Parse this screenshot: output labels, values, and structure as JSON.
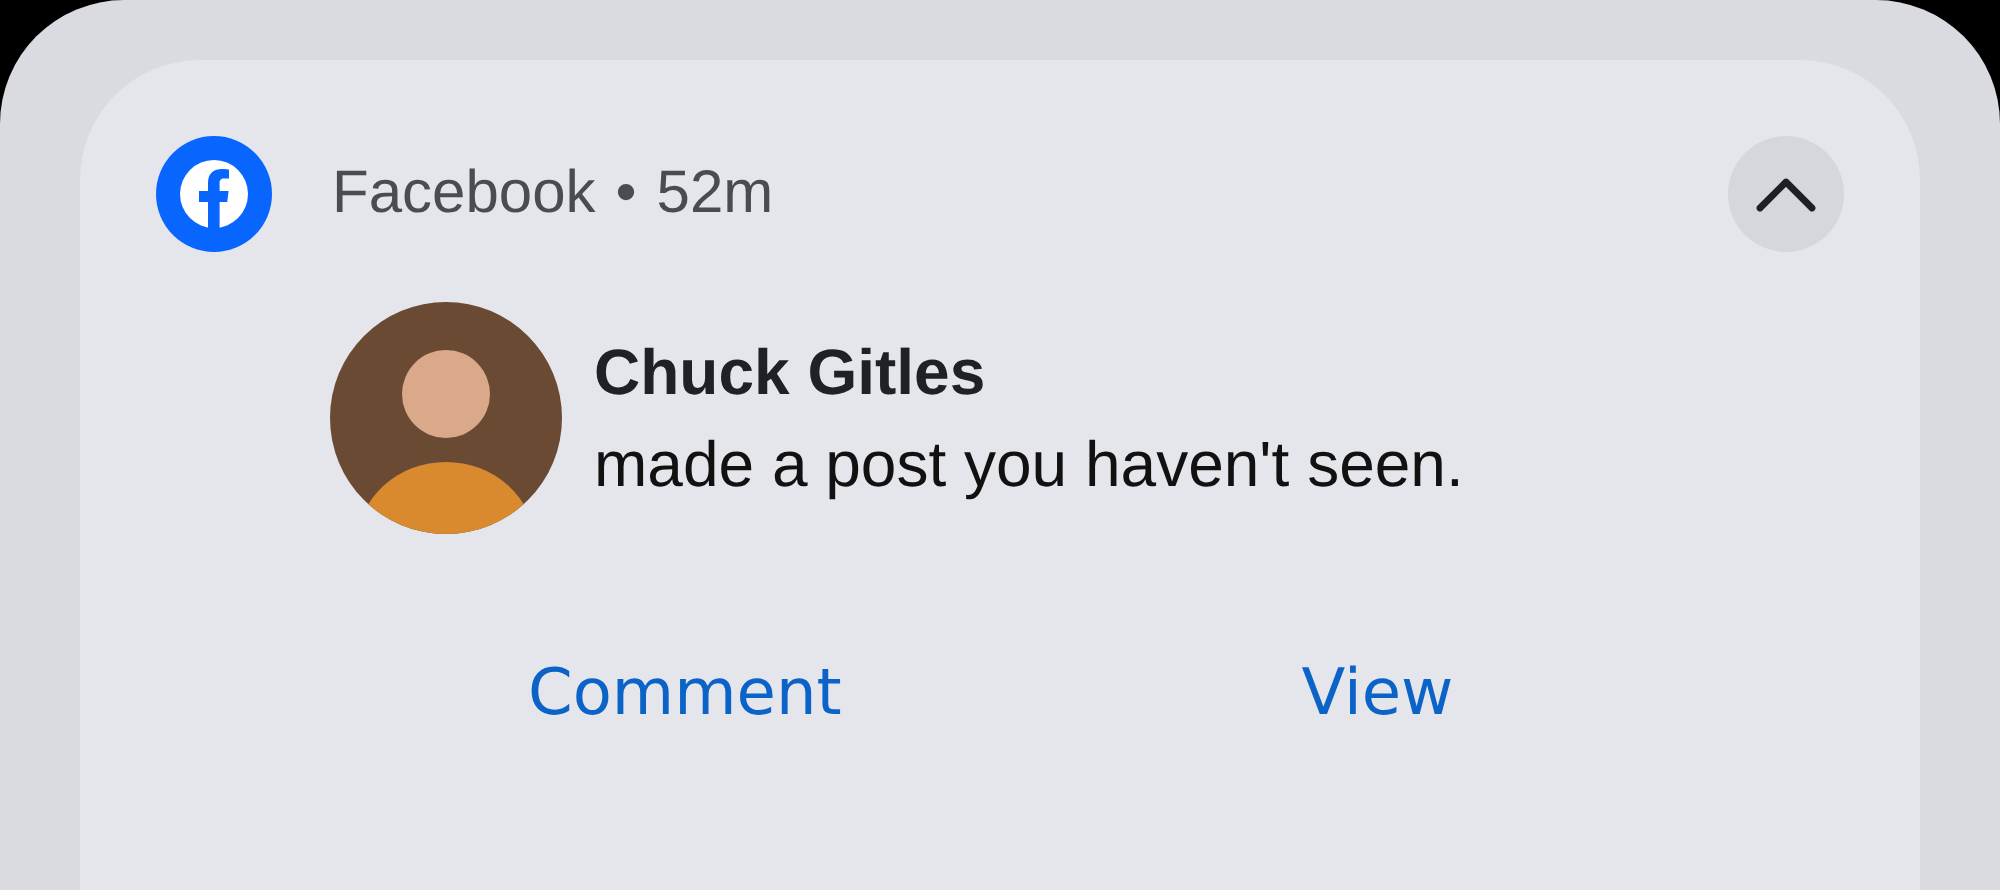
{
  "notification": {
    "app": "Facebook",
    "separator": "•",
    "time": "52m",
    "expanded": true,
    "sender": "Chuck Gitles",
    "message": "made a post you haven't seen.",
    "actions": [
      "Comment",
      "View"
    ]
  }
}
